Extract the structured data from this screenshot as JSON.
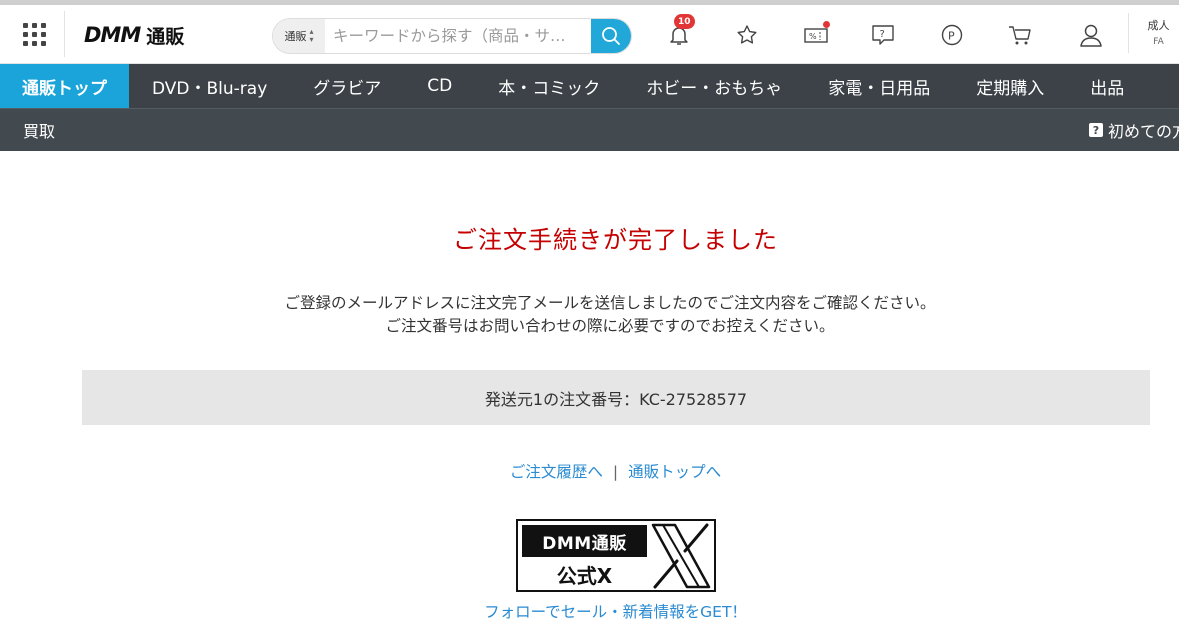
{
  "header": {
    "logo_text": "DMM",
    "logo_sub": "通販",
    "search": {
      "category": "通販",
      "placeholder": "キーワードから探す（商品・サ…"
    },
    "notification_count": "10",
    "adult_label": "成人",
    "adult_sub": "FA"
  },
  "nav": {
    "primary": [
      {
        "label": "通販トップ",
        "active": true
      },
      {
        "label": "DVD・Blu-ray"
      },
      {
        "label": "グラビア"
      },
      {
        "label": "CD"
      },
      {
        "label": "本・コミック"
      },
      {
        "label": "ホビー・おもちゃ"
      },
      {
        "label": "家電・日用品"
      },
      {
        "label": "定期購入"
      },
      {
        "label": "出品"
      }
    ],
    "secondary_left": "買取",
    "secondary_right": "初めての方",
    "help_glyph": "?"
  },
  "main": {
    "title": "ご注文手続きが完了しました",
    "message_line1": "ご登録のメールアドレスに注文完了メールを送信しましたのでご注文内容をご確認ください。",
    "message_line2": "ご注文番号はお問い合わせの際に必要ですのでお控えください。",
    "order_number_text": "発送元1の注文番号：KC-27528577",
    "link_history": "ご注文履歴へ",
    "link_separator": "|",
    "link_top": "通販トップへ",
    "banner_line1": "DMM通販",
    "banner_line2": "公式X",
    "follow_text": "フォローでセール・新着情報をGET！"
  },
  "colors": {
    "accent": "#1ba4d9",
    "nav_bg": "#3c4247",
    "title_red": "#c40000",
    "link_blue": "#2a8bd2"
  }
}
